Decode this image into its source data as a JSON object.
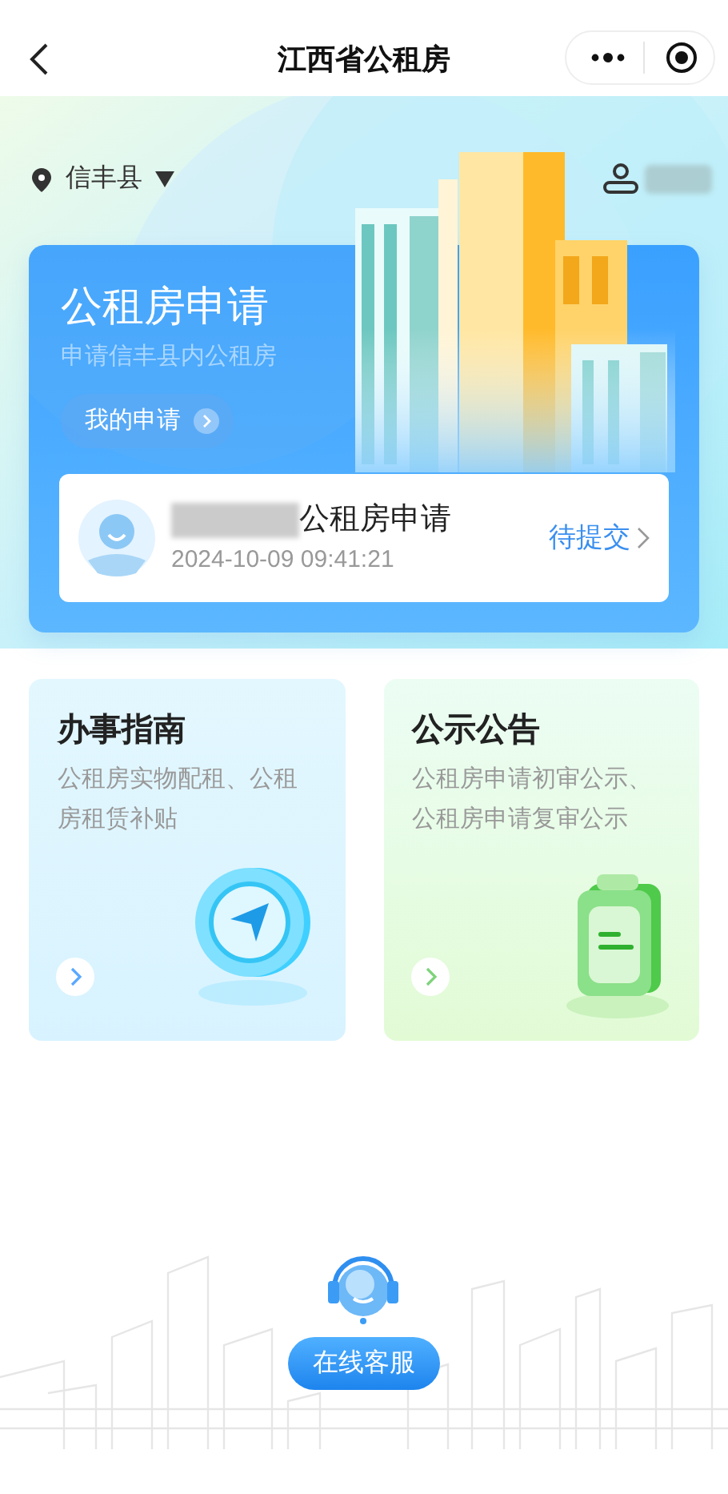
{
  "nav": {
    "title": "江西省公租房"
  },
  "location": {
    "label": "信丰县"
  },
  "apply_card": {
    "title": "公租房申请",
    "subtitle": "申请信丰县内公租房",
    "my_button": "我的申请",
    "record": {
      "title": "公租房申请",
      "time": "2024-10-09 09:41:21",
      "status": "待提交"
    }
  },
  "tiles": [
    {
      "kind": "guide",
      "title": "办事指南",
      "desc": "公租房实物配租、公租房租赁补贴"
    },
    {
      "kind": "notice",
      "title": "公示公告",
      "desc": "公租房申请初审公示、公租房申请复审公示"
    }
  ],
  "service_button": "在线客服"
}
